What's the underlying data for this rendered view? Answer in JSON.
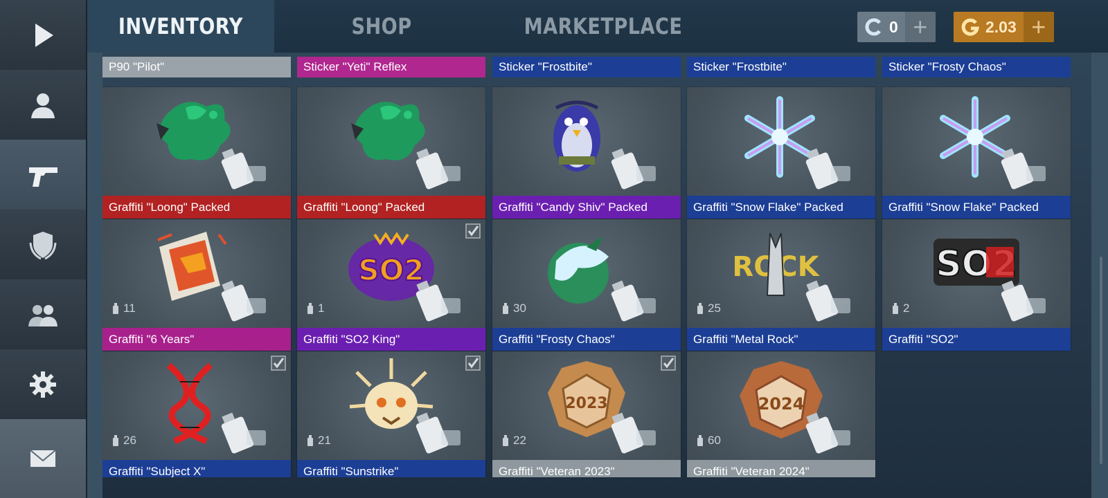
{
  "sidebar": {
    "items": [
      {
        "name": "play-icon"
      },
      {
        "name": "profile-icon"
      },
      {
        "name": "pistol-icon"
      },
      {
        "name": "shield-icon"
      },
      {
        "name": "friends-icon"
      },
      {
        "name": "gear-icon"
      },
      {
        "name": "mail-icon"
      }
    ]
  },
  "tabs": [
    {
      "label": "INVENTORY",
      "active": true
    },
    {
      "label": "SHOP",
      "active": false
    },
    {
      "label": "MARKETPLACE",
      "active": false
    }
  ],
  "currency": {
    "coins": {
      "value": "0",
      "color": "#6a7a86",
      "icon": "coin-c-icon"
    },
    "gold": {
      "value": "2.03",
      "color": "#b87a22",
      "icon": "gold-g-icon"
    }
  },
  "top_row": [
    {
      "label": "P90 \"Pilot\"",
      "color": "#9aa3a9"
    },
    {
      "label": "Sticker \"Yeti\" Reflex",
      "color": "#b0278f"
    },
    {
      "label": "Sticker \"Frostbite\"",
      "color": "#1c3e95"
    },
    {
      "label": "Sticker \"Frostbite\"",
      "color": "#1c3e95"
    },
    {
      "label": "Sticker \"Frosty Chaos\"",
      "color": "#1c3e95"
    }
  ],
  "items": [
    {
      "label": "Graffiti \"Loong\" Packed",
      "color": "#b22222",
      "art": "loong",
      "count": "",
      "checked": false
    },
    {
      "label": "Graffiti \"Loong\" Packed",
      "color": "#b22222",
      "art": "loong",
      "count": "",
      "checked": false
    },
    {
      "label": "Graffiti \"Candy Shiv\" Packed",
      "color": "#6b1fb0",
      "art": "penguin",
      "count": "",
      "checked": false
    },
    {
      "label": "Graffiti \"Snow Flake\" Packed",
      "color": "#1c3e95",
      "art": "snowflake",
      "count": "",
      "checked": false
    },
    {
      "label": "Graffiti \"Snow Flake\" Packed",
      "color": "#1c3e95",
      "art": "snowflake",
      "count": "",
      "checked": false
    },
    {
      "label": "Graffiti \"6 Years\"",
      "color": "#a8208c",
      "art": "sixyears",
      "count": "11",
      "checked": false
    },
    {
      "label": "Graffiti \"SO2 King\"",
      "color": "#6b1fb0",
      "art": "so2king",
      "count": "1",
      "checked": true
    },
    {
      "label": "Graffiti \"Frosty Chaos\"",
      "color": "#1c3e95",
      "art": "frostychaos",
      "count": "30",
      "checked": false
    },
    {
      "label": "Graffiti \"Metal Rock\"",
      "color": "#1c3e95",
      "art": "metalrock",
      "count": "25",
      "checked": false
    },
    {
      "label": "Graffiti \"SO2\"",
      "color": "#1c3e95",
      "art": "so2",
      "count": "2",
      "checked": false
    },
    {
      "label": "Graffiti \"Subject X\"",
      "color": "#1c3e95",
      "art": "subjectx",
      "count": "26",
      "checked": true
    },
    {
      "label": "Graffiti \"Sunstrike\"",
      "color": "#1c3e95",
      "art": "sunstrike",
      "count": "21",
      "checked": true
    },
    {
      "label": "Graffiti \"Veteran 2023\"",
      "color": "#8e989e",
      "art": "vet2023",
      "count": "22",
      "checked": true
    },
    {
      "label": "Graffiti \"Veteran 2024\"",
      "color": "#8e989e",
      "art": "vet2024",
      "count": "60",
      "checked": false
    }
  ],
  "art_text": {
    "so2king": "SO2",
    "so2": "SO2",
    "rock": "ROCK",
    "vet2023_year": "2023",
    "vet2024_year": "2024"
  }
}
